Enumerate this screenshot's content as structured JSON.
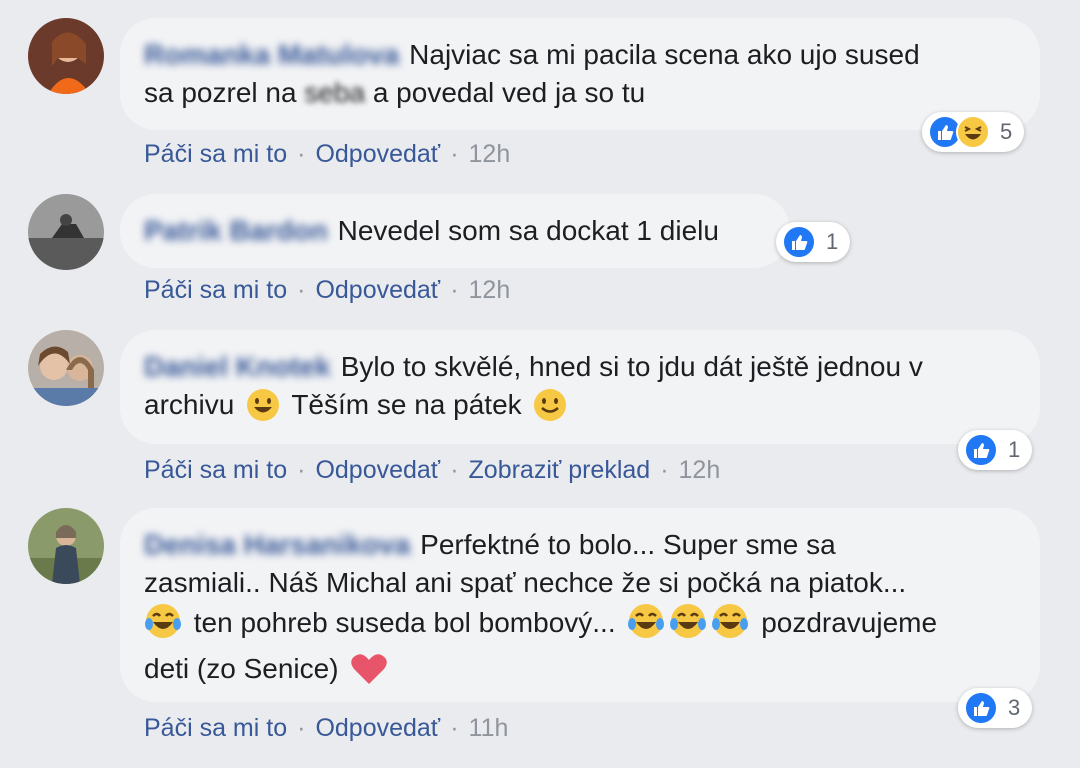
{
  "comments": [
    {
      "author": "Romanka Matulova",
      "text1": "Najviac sa mi pacila scena ako ujo sused",
      "text2a": "sa pozrel na ",
      "text2b": "seba",
      "text2c": " a povedal ved ja so tu",
      "like": "Páči sa mi to",
      "reply": "Odpovedať",
      "time": "12h",
      "reaction_count": "5"
    },
    {
      "author": "Patrik Bardon",
      "text1": "Nevedel som sa dockat 1 dielu",
      "like": "Páči sa mi to",
      "reply": "Odpovedať",
      "time": "12h",
      "reaction_count": "1"
    },
    {
      "author": "Daniel Knotek",
      "text1": "Bylo to skvělé, hned si to jdu dát ještě jednou v",
      "text2a": "archivu",
      "text2b": "Těším se na pátek",
      "like": "Páči sa mi to",
      "reply": "Odpovedať",
      "translate": "Zobraziť preklad",
      "time": "12h",
      "reaction_count": "1"
    },
    {
      "author": "Denisa Harsanikova",
      "text1": "Perfektné to bolo... Super sme sa",
      "text2": "zasmiali.. Náš Michal ani spať nechce že si počká na piatok...",
      "text3a": "ten pohreb suseda bol bombový...",
      "text3b": "pozdravujeme",
      "text4": "deti (zo Senice)",
      "like": "Páči sa mi to",
      "reply": "Odpovedať",
      "time": "11h",
      "reaction_count": "3"
    }
  ],
  "colors": {
    "background": "#e9ebee",
    "bubble": "#f2f3f5",
    "link": "#385898",
    "like_blue": "#2078f4",
    "meta": "#90949c"
  },
  "icons": [
    "thumbs-up-icon",
    "haha-icon",
    "smile-emoji-icon",
    "tears-of-joy-icon",
    "heart-icon"
  ]
}
